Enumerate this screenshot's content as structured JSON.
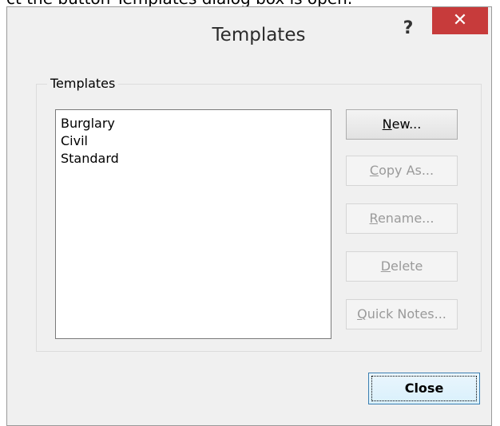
{
  "background_caption": "ct the button Templates dialog box is open.",
  "window": {
    "title": "Templates",
    "help_label": "?",
    "close_label": "✕"
  },
  "group": {
    "label": "Templates",
    "items": [
      "Burglary",
      "Civil",
      "Standard"
    ]
  },
  "buttons": {
    "new": {
      "mnemonic": "N",
      "rest": "ew..."
    },
    "copy_as": {
      "mnemonic": "C",
      "rest": "opy As..."
    },
    "rename": {
      "mnemonic": "R",
      "rest": "ename..."
    },
    "delete": {
      "mnemonic": "D",
      "rest": "elete"
    },
    "quick_notes": {
      "mnemonic": "Q",
      "rest": "uick Notes..."
    },
    "close": "Close"
  },
  "colors": {
    "close_accent": "#c73b3b",
    "default_button_border": "#3c7fb1"
  }
}
